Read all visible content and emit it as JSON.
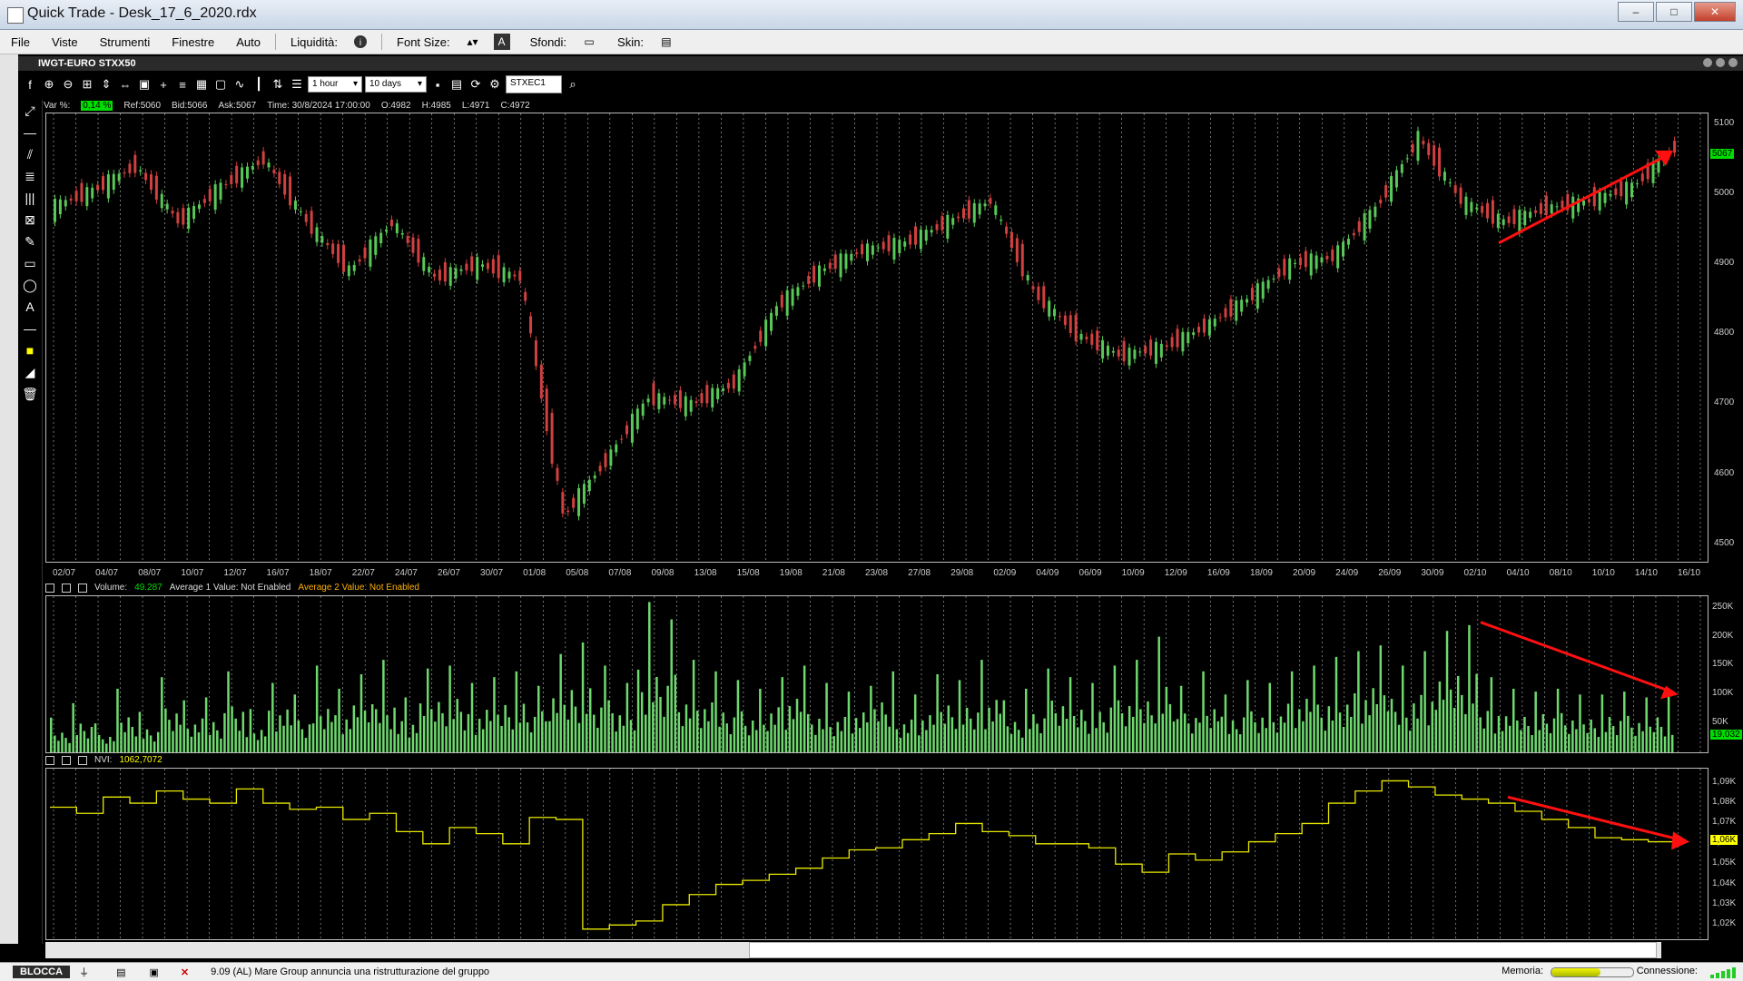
{
  "window": {
    "title": "Quick Trade - Desk_17_6_2020.rdx",
    "min_label": "–",
    "max_label": "□",
    "close_label": "✕"
  },
  "menu": {
    "items": [
      "File",
      "Viste",
      "Strumenti",
      "Finestre",
      "Auto"
    ],
    "liquidita_label": "Liquidità:",
    "font_size_label": "Font Size:",
    "sfondi_label": "Sfondi:",
    "skin_label": "Skin:"
  },
  "chart_window": {
    "title": "IWGT-EURO STXX50"
  },
  "toolbar": {
    "timeframe": "1 hour",
    "range": "10 days",
    "symbol": "STXEC1"
  },
  "info": {
    "var_label": "Var %:",
    "var_value": "0,14 %",
    "ref": "Ref:5060",
    "bid": "Bid:5066",
    "ask": "Ask:5067",
    "time": "Time:  30/8/2024 17:00:00",
    "open": "O:4982",
    "high": "H:4985",
    "low": "L:4971",
    "close": "C:4972"
  },
  "volume_panel": {
    "label": "Volume:",
    "value": "49.287",
    "avg1": "Average 1 Value:  Not Enabled",
    "avg2": "Average 2 Value:  Not Enabled",
    "last_tag": "19,032"
  },
  "nvi_panel": {
    "label": "NVI:",
    "value": "1062,7072",
    "last_tag": "1,06K"
  },
  "price_last_tag": "5067",
  "status": {
    "blocca": "BLOCCA",
    "news": "9.09 (AL) Mare Group annuncia una ristrutturazione del gruppo",
    "memoria": "Memoria:",
    "connessione": "Connessione:"
  },
  "colors": {
    "up": "#58c858",
    "down": "#d04040",
    "volume": "#6ed96e",
    "nvi": "#e8e800",
    "trend_arrow": "#ff1010"
  },
  "chart_data": [
    {
      "type": "line",
      "title": "IWGT-EURO STXX50",
      "x_ticks": [
        "02/07",
        "04/07",
        "08/07",
        "10/07",
        "12/07",
        "16/07",
        "18/07",
        "22/07",
        "24/07",
        "26/07",
        "30/07",
        "01/08",
        "05/08",
        "07/08",
        "09/08",
        "13/08",
        "15/08",
        "19/08",
        "21/08",
        "23/08",
        "27/08",
        "29/08",
        "02/09",
        "04/09",
        "06/09",
        "10/09",
        "12/09",
        "16/09",
        "18/09",
        "20/09",
        "24/09",
        "26/09",
        "30/09",
        "02/10",
        "04/10",
        "08/10",
        "10/10",
        "14/10",
        "16/10"
      ],
      "y_ticks": [
        4500,
        4600,
        4700,
        4800,
        4900,
        5000,
        5100
      ],
      "ylim": [
        4475,
        5115
      ],
      "series": [
        {
          "x": [
            "02/07",
            "04/07",
            "08/07",
            "10/07",
            "12/07",
            "16/07",
            "18/07",
            "22/07",
            "24/07",
            "26/07",
            "30/07",
            "01/08",
            "05/08",
            "07/08",
            "09/08",
            "13/08",
            "15/08",
            "19/08",
            "21/08",
            "23/08",
            "27/08",
            "29/08",
            "02/09",
            "04/09",
            "06/09",
            "10/09",
            "12/09",
            "16/09",
            "18/09",
            "20/09",
            "24/09",
            "26/09",
            "30/09",
            "02/10",
            "04/10",
            "08/10",
            "10/10",
            "14/10",
            "16/10"
          ],
          "values": [
            4980,
            5005,
            5040,
            4960,
            5010,
            5050,
            4960,
            4890,
            4960,
            4880,
            4900,
            4880,
            4540,
            4620,
            4710,
            4700,
            4730,
            4840,
            4890,
            4920,
            4930,
            4960,
            4990,
            4860,
            4800,
            4770,
            4780,
            4810,
            4850,
            4900,
            4910,
            4980,
            5080,
            4990,
            4960,
            4980,
            4990,
            5010,
            5067
          ]
        }
      ]
    },
    {
      "type": "bar",
      "title": "Volume",
      "y_ticks": [
        "50K",
        "100K",
        "150K",
        "200K",
        "250K"
      ],
      "ylim": [
        0,
        270000
      ],
      "series": [
        {
          "name": "Volume",
          "values": [
            60000,
            85000,
            50000,
            110000,
            70000,
            130000,
            90000,
            95000,
            140000,
            75000,
            120000,
            100000,
            150000,
            110000,
            135000,
            160000,
            95000,
            145000,
            150000,
            120000,
            130000,
            140000,
            115000,
            170000,
            190000,
            150000,
            120000,
            260000,
            230000,
            160000,
            140000,
            125000,
            110000,
            130000,
            150000,
            120000,
            105000,
            115000,
            140000,
            100000,
            110000,
            135000,
            125000,
            160000,
            90000,
            110000,
            145000,
            130000,
            120000,
            150000,
            160000,
            200000,
            115000,
            140000,
            100000,
            125000,
            120000,
            140000,
            150000,
            165000,
            175000,
            185000,
            150000,
            175000,
            210000,
            220000,
            130000,
            110000,
            105000,
            110000,
            100000,
            100000,
            105000,
            95000,
            110000,
            90000
          ]
        }
      ]
    },
    {
      "type": "line",
      "title": "NVI",
      "y_ticks": [
        "1,02K",
        "1,03K",
        "1,04K",
        "1,05K",
        "1,06K",
        "1,07K",
        "1,08K",
        "1,09K"
      ],
      "ylim": [
        1013,
        1097
      ],
      "series": [
        {
          "name": "NVI",
          "values": [
            1078,
            1075,
            1083,
            1080,
            1086,
            1082,
            1080,
            1087,
            1080,
            1077,
            1078,
            1072,
            1075,
            1066,
            1060,
            1068,
            1065,
            1060,
            1073,
            1072,
            1018,
            1020,
            1022,
            1030,
            1035,
            1040,
            1042,
            1045,
            1048,
            1053,
            1057,
            1058,
            1062,
            1065,
            1070,
            1066,
            1064,
            1060,
            1060,
            1058,
            1050,
            1046,
            1055,
            1052,
            1056,
            1061,
            1065,
            1070,
            1080,
            1086,
            1091,
            1088,
            1084,
            1082,
            1080,
            1076,
            1072,
            1068,
            1063,
            1062,
            1061,
            1063
          ]
        }
      ]
    }
  ]
}
